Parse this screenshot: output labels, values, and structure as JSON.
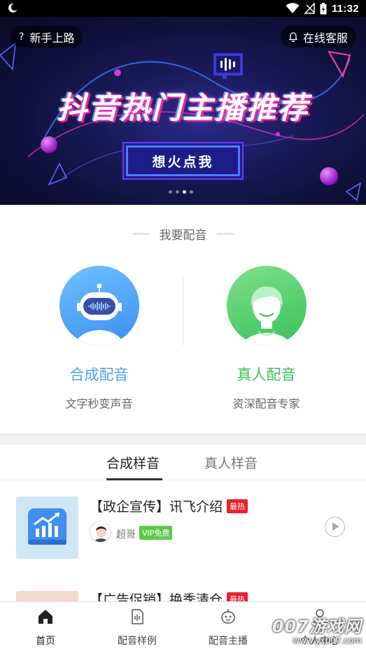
{
  "status_bar": {
    "time": "11:32",
    "icons": [
      "moon-icon",
      "wifi-icon",
      "signal-icon",
      "battery-icon"
    ]
  },
  "banner": {
    "help_label": "新手上路",
    "service_label": "在线客服",
    "headline": "抖音热门主播推荐",
    "cta": "想火点我",
    "pages": 4,
    "active_page": 3
  },
  "dub_section": {
    "title": "我要配音",
    "synthetic": {
      "title": "合成配音",
      "subtitle": "文字秒变声音"
    },
    "human": {
      "title": "真人配音",
      "subtitle": "资深配音专家"
    }
  },
  "tabs": [
    {
      "label": "合成样音",
      "active": true
    },
    {
      "label": "真人样音",
      "active": false
    }
  ],
  "samples": [
    {
      "title": "【政企宣传】讯飞介绍",
      "badge": "最热",
      "author": "超哥",
      "vip": "VIP免费"
    },
    {
      "title": "【广告促销】换季清仓",
      "badge": "最热"
    }
  ],
  "bottom_nav": [
    {
      "label": "首页",
      "icon": "home-icon",
      "active": true
    },
    {
      "label": "配音样例",
      "icon": "document-audio-icon",
      "active": false
    },
    {
      "label": "配音主播",
      "icon": "robot-face-icon",
      "active": false
    },
    {
      "label": "个人中心",
      "icon": "person-icon",
      "active": false
    }
  ],
  "watermark": {
    "brand": "007游戏网",
    "url": "www.yx007.com"
  },
  "colors": {
    "synthetic": "#4ea1e8",
    "human": "#3cbf5a",
    "hot_badge": "#e8222c",
    "vip": "#5fc84b"
  }
}
